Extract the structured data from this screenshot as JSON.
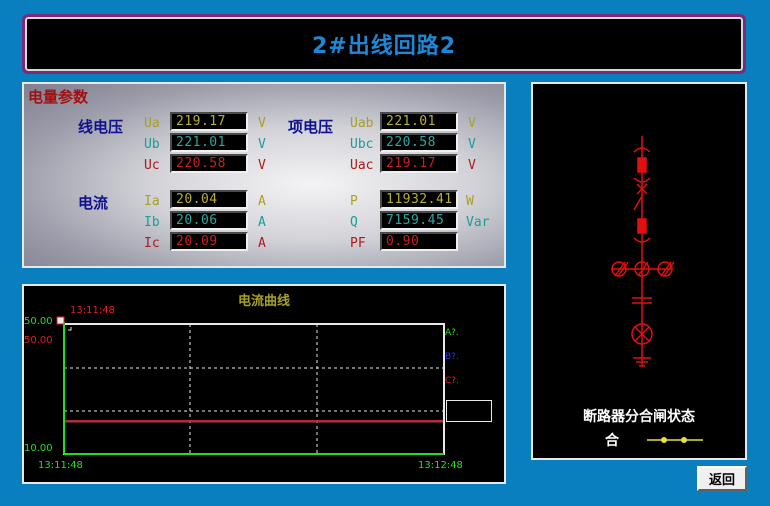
{
  "header": {
    "title": "2#出线回路2"
  },
  "params": {
    "section_title": "电量参数",
    "line_voltage_label": "线电压",
    "phase_voltage_label": "项电压",
    "current_label": "电流",
    "rows": {
      "ua": {
        "name": "Ua",
        "value": "219.17",
        "unit": "V"
      },
      "ub": {
        "name": "Ub",
        "value": "221.01",
        "unit": "V"
      },
      "uc": {
        "name": "Uc",
        "value": "220.58",
        "unit": "V"
      },
      "uab": {
        "name": "Uab",
        "value": "221.01",
        "unit": "V"
      },
      "ubc": {
        "name": "Ubc",
        "value": "220.58",
        "unit": "V"
      },
      "uac": {
        "name": "Uac",
        "value": "219.17",
        "unit": "V"
      },
      "ia": {
        "name": "Ia",
        "value": "20.04",
        "unit": "A"
      },
      "ib": {
        "name": "Ib",
        "value": "20.06",
        "unit": "A"
      },
      "ic": {
        "name": "Ic",
        "value": "20.09",
        "unit": "A"
      },
      "p": {
        "name": "P",
        "value": "11932.41",
        "unit": "W"
      },
      "q": {
        "name": "Q",
        "value": "7159.45",
        "unit": "Var"
      },
      "pf": {
        "name": "PF",
        "value": "0.90",
        "unit": ""
      }
    }
  },
  "chart": {
    "title": "电流曲线",
    "cursor_time": "13:11:48",
    "y_top_green": "50.00",
    "y_top_red": "50.00",
    "y_bottom": "10.00",
    "x_start": "13:11:48",
    "x_end": "13:12:48",
    "legend": [
      "A?.",
      "B?.",
      "C?."
    ]
  },
  "chart_data": {
    "type": "line",
    "title": "电流曲线",
    "x": [
      "13:11:48",
      "13:12:48"
    ],
    "ylim": [
      10,
      50
    ],
    "series": [
      {
        "name": "A?.",
        "color": "#c0c000",
        "values": [
          20.04,
          20.04
        ]
      },
      {
        "name": "B?.",
        "color": "#3030e0",
        "values": [
          20.06,
          20.06
        ]
      },
      {
        "name": "C?.",
        "color": "#e02020",
        "values": [
          20.09,
          20.09
        ]
      }
    ]
  },
  "diagram": {
    "breaker_status_title": "断路器分合闸状态",
    "breaker_status_value": "合"
  },
  "footer": {
    "back_label": "返回"
  },
  "colors": {
    "background": "#0a7fc0",
    "title_text": "#1e88d8",
    "yellow_value": "#b8b030",
    "teal_value": "#2aa8a0",
    "red_value": "#c82020",
    "diagram_red": "#e01010"
  }
}
